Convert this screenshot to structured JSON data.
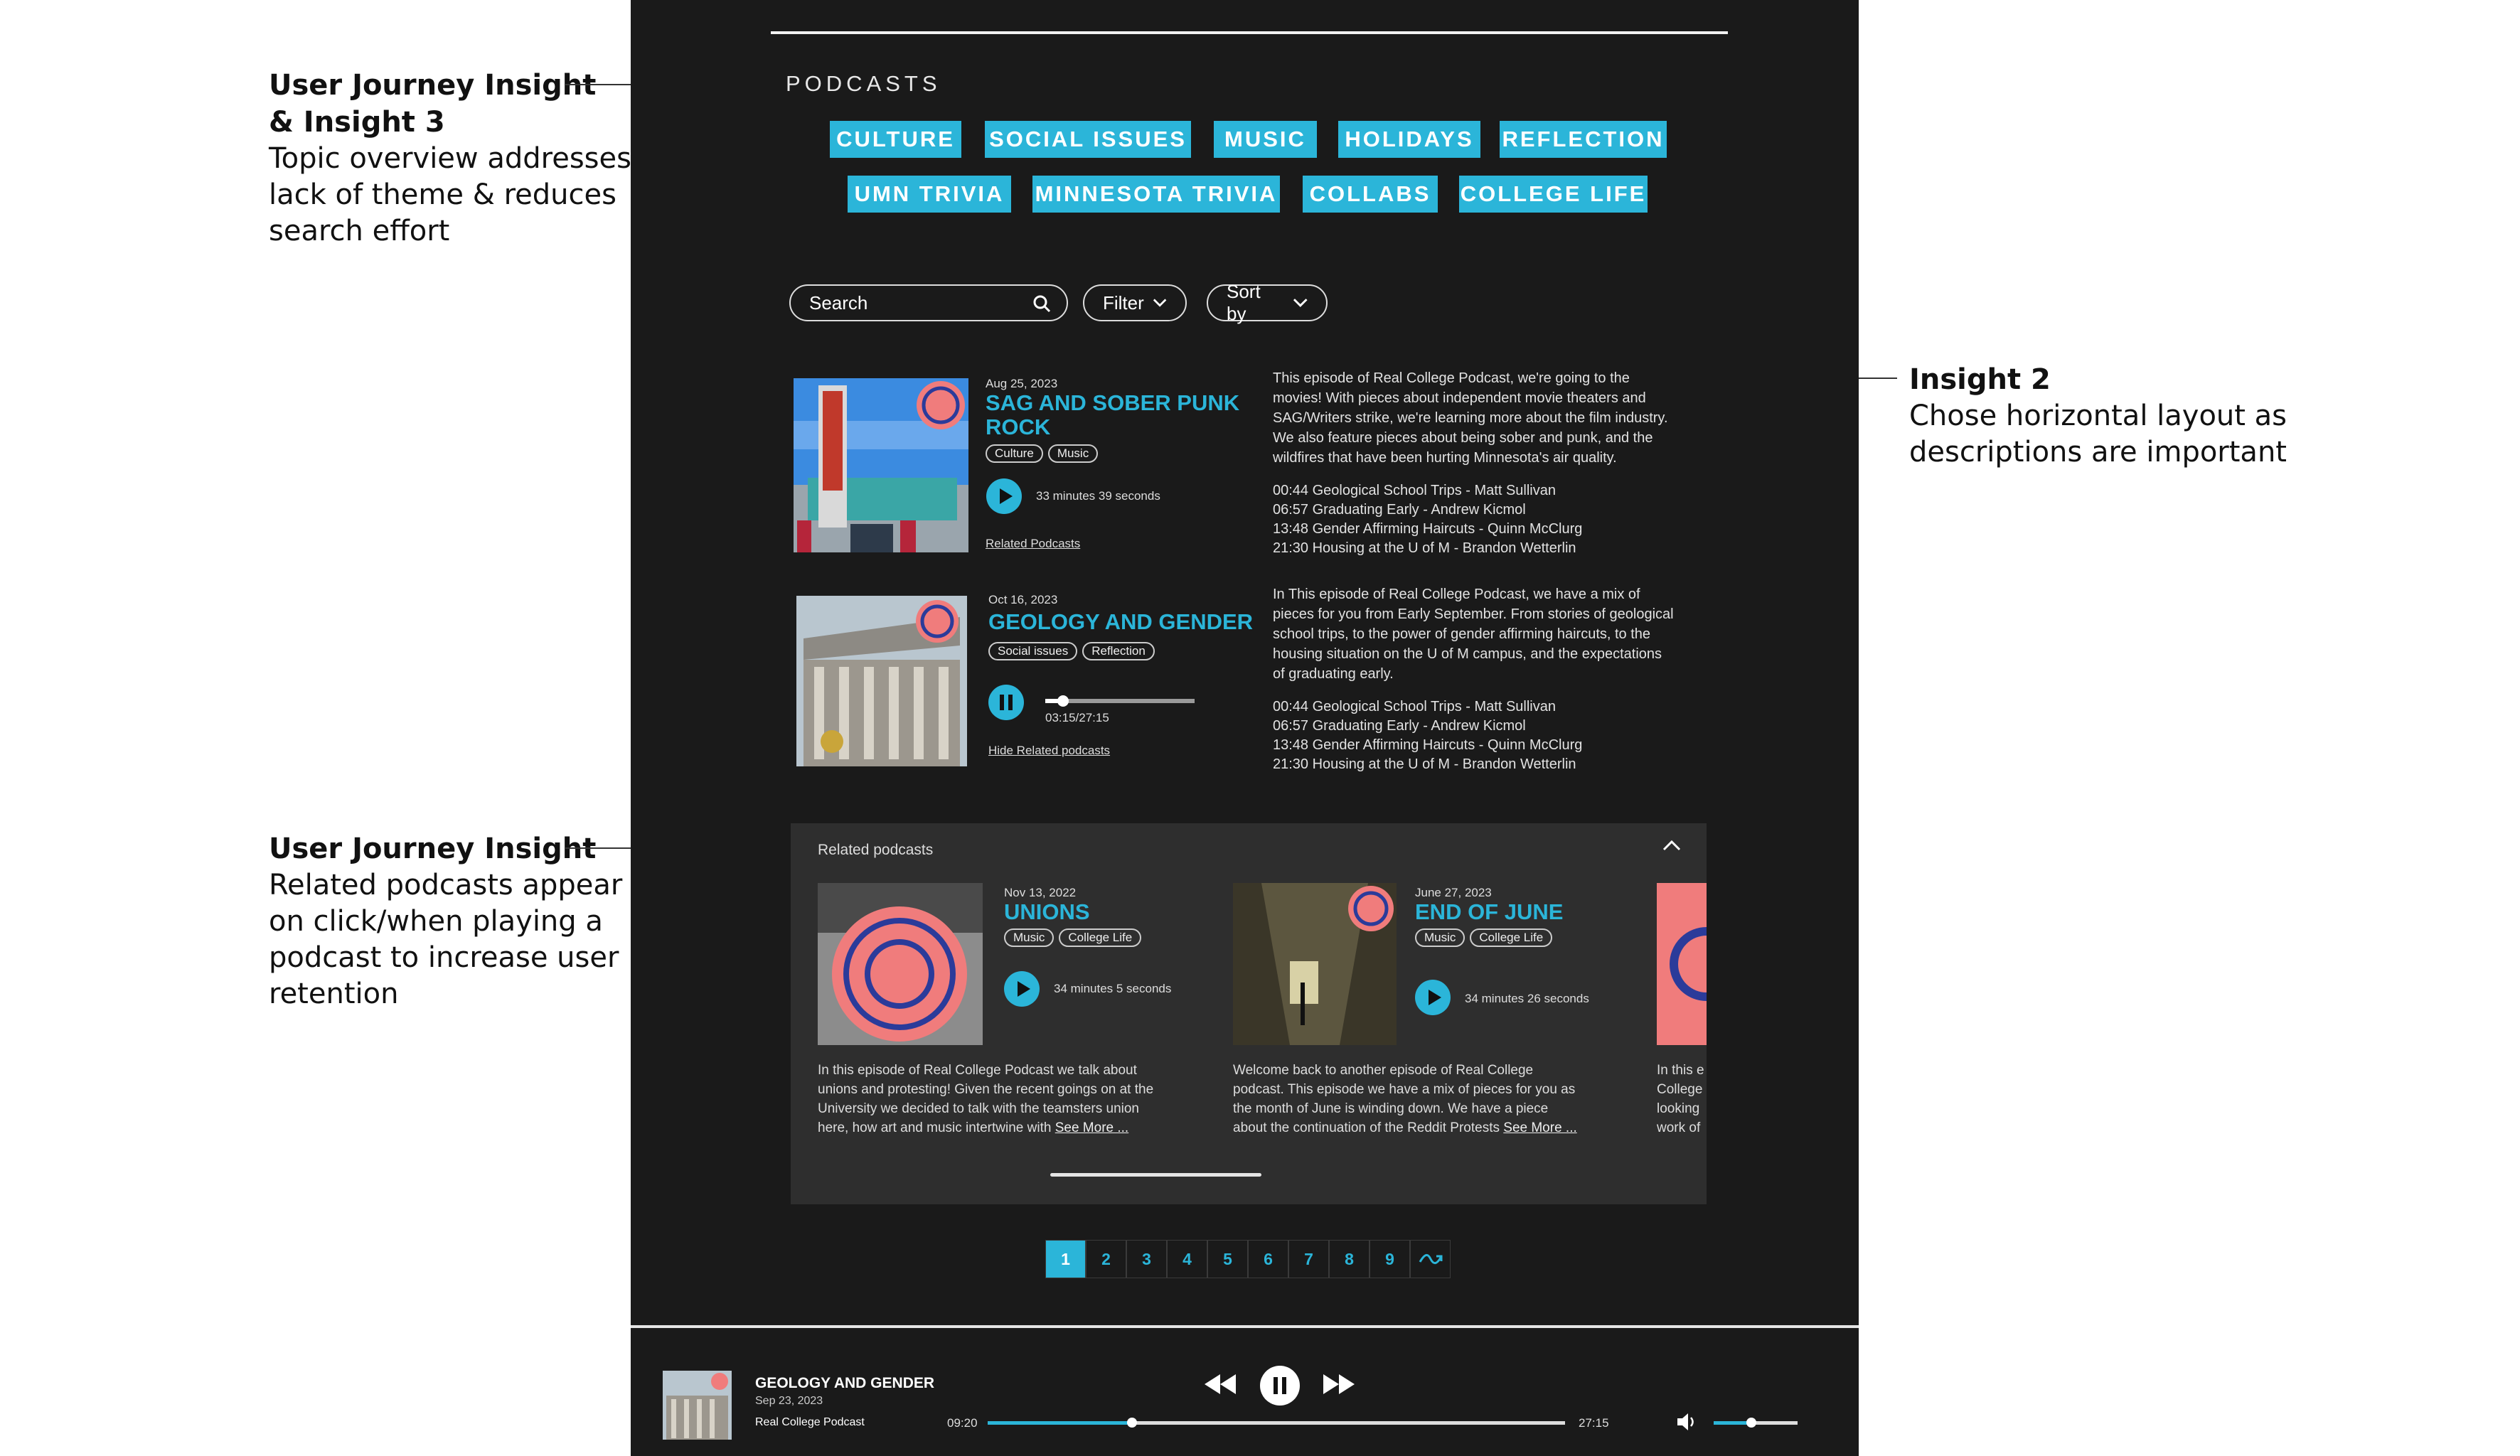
{
  "annotations": [
    {
      "title_lines": [
        "User Journey Insight",
        "& Insight 3"
      ],
      "body_lines": [
        "Topic overview addresses",
        "lack of theme & reduces",
        "search effort"
      ]
    },
    {
      "title_lines": [
        "Insight 2"
      ],
      "body_lines": [
        "Chose horizontal layout as",
        "descriptions are important"
      ]
    },
    {
      "title_lines": [
        "User Journey Insight"
      ],
      "body_lines": [
        "Related podcasts appear",
        "on click/when playing a",
        "podcast to increase user",
        "retention"
      ]
    }
  ],
  "section_heading": "PODCASTS",
  "topics": [
    "CULTURE",
    "SOCIAL ISSUES",
    "MUSIC",
    "HOLIDAYS",
    "REFLECTION",
    "UMN TRIVIA",
    "MINNESOTA TRIVIA",
    "COLLABS",
    "COLLEGE LIFE"
  ],
  "colors": {
    "accent": "#2bb5d9",
    "background": "#1a1a1a",
    "panel": "#2e2e2e",
    "text": "#ffffff"
  },
  "controls": {
    "search_placeholder": "Search",
    "filter_label": "Filter",
    "sort_label": "Sort by"
  },
  "episodes": [
    {
      "date": "Aug 25, 2023",
      "title_lines": [
        "SAG AND SOBER PUNK",
        "ROCK"
      ],
      "tags": [
        "Culture",
        "Music"
      ],
      "state": "paused",
      "duration": "33 minutes 39 seconds",
      "related_link": "Related Podcasts",
      "description_lines": [
        "This episode of Real College Podcast, we're going to the",
        "movies! With pieces about independent movie theaters and",
        "SAG/Writers strike, we're learning more about the film industry.",
        "We also feature pieces about being sober and punk, and the",
        "wildfires that have been hurting Minnesota's air quality."
      ],
      "tracks": [
        "00:44  Geological School Trips - Matt Sullivan",
        "06:57  Graduating Early - Andrew Kicmol",
        "13:48  Gender Affirming Haircuts - Quinn McClurg",
        "21:30  Housing at the U of M - Brandon Wetterlin"
      ]
    },
    {
      "date": "Oct 16, 2023",
      "title_lines": [
        "GEOLOGY AND GENDER"
      ],
      "tags": [
        "Social issues",
        "Reflection"
      ],
      "state": "playing",
      "progress_text": "03:15/27:15",
      "progress_fraction": 0.12,
      "related_link": "Hide Related podcasts",
      "description_lines": [
        "In This episode of Real College Podcast, we have a mix of",
        "pieces for you from Early September. From stories of geological",
        "school trips, to the power of gender affirming haircuts, to the",
        "housing situation on the U of M campus, and the expectations",
        "of graduating early."
      ],
      "tracks": [
        "00:44  Geological School Trips - Matt Sullivan",
        "06:57  Graduating Early - Andrew Kicmol",
        "13:48  Gender Affirming Haircuts - Quinn McClurg",
        "21:30  Housing at the U of M - Brandon Wetterlin"
      ]
    }
  ],
  "related": {
    "title": "Related podcasts",
    "items": [
      {
        "date": "Nov 13, 2022",
        "title": "UNIONS",
        "tags": [
          "Music",
          "College Life"
        ],
        "duration": "34 minutes 5 seconds",
        "description_lines": [
          "In this episode of Real College Podcast we talk about",
          "unions and protesting! Given the recent goings on at the",
          "University we decided to talk with the teamsters union",
          "here, how art and music intertwine with"
        ],
        "see_more": "See More ..."
      },
      {
        "date": "June 27, 2023",
        "title": "END OF JUNE",
        "tags": [
          "Music",
          "College Life"
        ],
        "duration": "34 minutes 26 seconds",
        "description_lines": [
          "Welcome back to another episode of Real College",
          "podcast. This episode we have a mix of pieces for you as",
          "the month of June is winding down. We have a piece",
          "about the continuation of the Reddit Protests"
        ],
        "see_more": "See More ..."
      },
      {
        "description_lines": [
          "In this e",
          "College",
          "looking",
          "work of"
        ]
      }
    ]
  },
  "pagination": {
    "pages": [
      "1",
      "2",
      "3",
      "4",
      "5",
      "6",
      "7",
      "8",
      "9"
    ],
    "current": "1"
  },
  "player": {
    "title": "GEOLOGY AND GENDER",
    "date": "Sep 23, 2023",
    "show": "Real College Podcast",
    "elapsed": "09:20",
    "total": "27:15",
    "progress_fraction": 0.25,
    "volume_fraction": 0.45
  }
}
